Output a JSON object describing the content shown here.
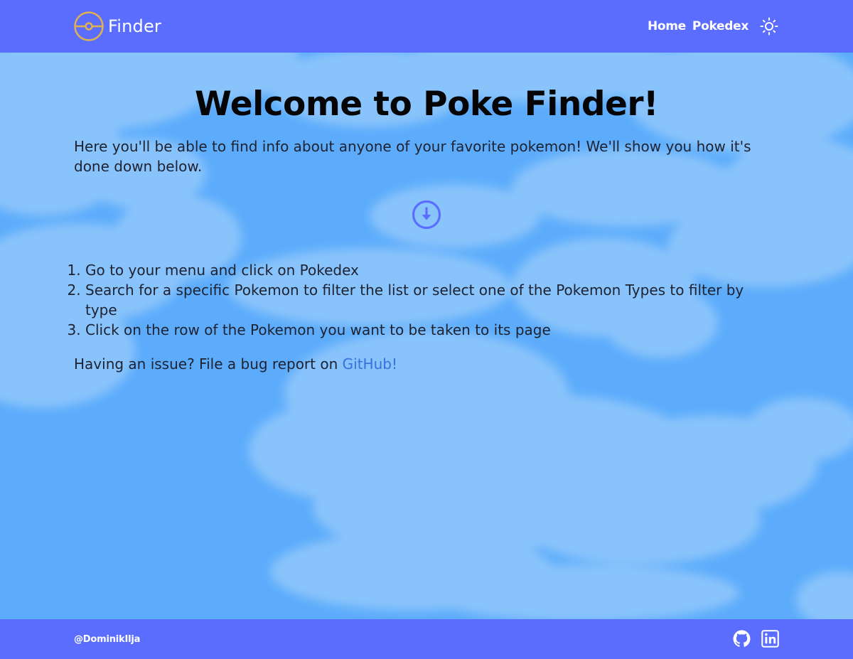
{
  "header": {
    "brand_name": "Finder",
    "nav": [
      {
        "label": "Home"
      },
      {
        "label": "Pokedex"
      }
    ],
    "theme_icon": "sun-icon"
  },
  "main": {
    "title": "Welcome to Poke Finder!",
    "intro": "Here you'll be able to find info about anyone of your favorite pokemon! We'll show you how it's done down below.",
    "scroll_icon": "arrow-down-circle-icon",
    "steps": [
      "Go to your menu and click on Pokedex",
      "Search for a specific Pokemon to filter the list or select one of the Pokemon Types to filter by type",
      "Click on the row of the Pokemon you want to be taken to its page"
    ],
    "issue_text": "Having an issue? File a bug report on ",
    "issue_link": "GitHub!"
  },
  "footer": {
    "handle": "@DominikIlja",
    "social_icons": [
      "github-icon",
      "linkedin-icon"
    ]
  },
  "colors": {
    "header_bg": "#5b6dfe",
    "footer_bg": "#5b6dfe",
    "sky": "#5cacfb",
    "cloud": "#8cc6fb",
    "logo_ring": "#e0b24f",
    "link": "#3a6fe0"
  }
}
